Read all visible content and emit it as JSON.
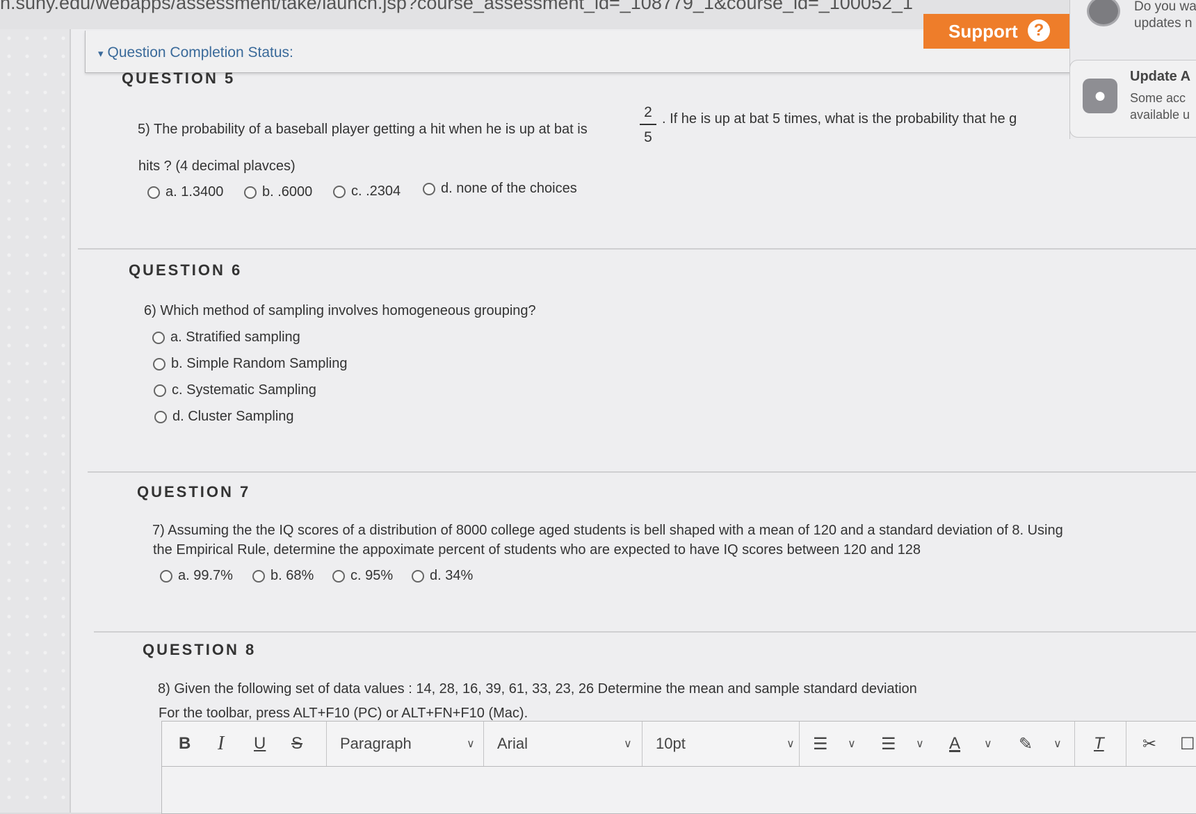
{
  "browser": {
    "url": "n.suny.edu/webapps/assessment/take/launch.jsp?course_assessment_id=_108779_1&course_id=_100052_1"
  },
  "header": {
    "status_label": "Question Completion Status:",
    "support_label": "Support",
    "help_glyph": "?"
  },
  "notification": {
    "line1": "Do you wa",
    "line2": "updates n",
    "title": "Update A",
    "body1": "Some acc",
    "body2": "available u"
  },
  "questions": [
    {
      "heading": "QUESTION 5",
      "text_before_fraction": "5) The probability of a baseball player getting a hit when he is up at bat is",
      "fraction_numerator": "2",
      "fraction_denominator": "5",
      "text_after_fraction": ". If he is up at bat 5 times, what is the probability that he g",
      "text_line2": "hits ? (4 decimal plavces)",
      "choices": [
        "a. 1.3400",
        "b. .6000",
        "c. .2304",
        "d. none of the choices"
      ]
    },
    {
      "heading": "QUESTION 6",
      "text": "6) Which method of sampling involves homogeneous grouping?",
      "choices": [
        "a. Stratified sampling",
        "b. Simple Random Sampling",
        "c. Systematic Sampling",
        "d. Cluster Sampling"
      ]
    },
    {
      "heading": "QUESTION 7",
      "text_line1": "7) Assuming the the IQ scores of a distribution of 8000 college aged students is bell shaped with a mean of 120 and a standard deviation of 8. Using",
      "text_line2": "the Empirical Rule, determine the appoximate  percent of students who are expected to have IQ scores between 120 and 128",
      "choices": [
        "a. 99.7%",
        "b. 68%",
        "c. 95%",
        "d. 34%"
      ]
    },
    {
      "heading": "QUESTION 8",
      "text_line1": "8) Given the following set of data values : 14, 28, 16, 39, 61, 33, 23, 26    Determine the mean and sample standard deviation",
      "toolbar_hint": "For the toolbar, press ALT+F10 (PC) or ALT+FN+F10 (Mac)."
    }
  ],
  "editor_toolbar": {
    "bold": "B",
    "italic": "I",
    "underline": "U",
    "strike": "S",
    "paragraph": "Paragraph",
    "font": "Arial",
    "size": "10pt",
    "text_color_glyph": "A",
    "clear_format_glyph": "T",
    "icons": [
      "bullet-list-icon",
      "numbered-list-icon",
      "text-color-icon",
      "highlight-icon",
      "clear-formatting-icon",
      "cut-icon",
      "copy-icon"
    ]
  },
  "colors": {
    "support_orange": "#ee7d2a",
    "status_link_blue": "#3a6a9a"
  }
}
